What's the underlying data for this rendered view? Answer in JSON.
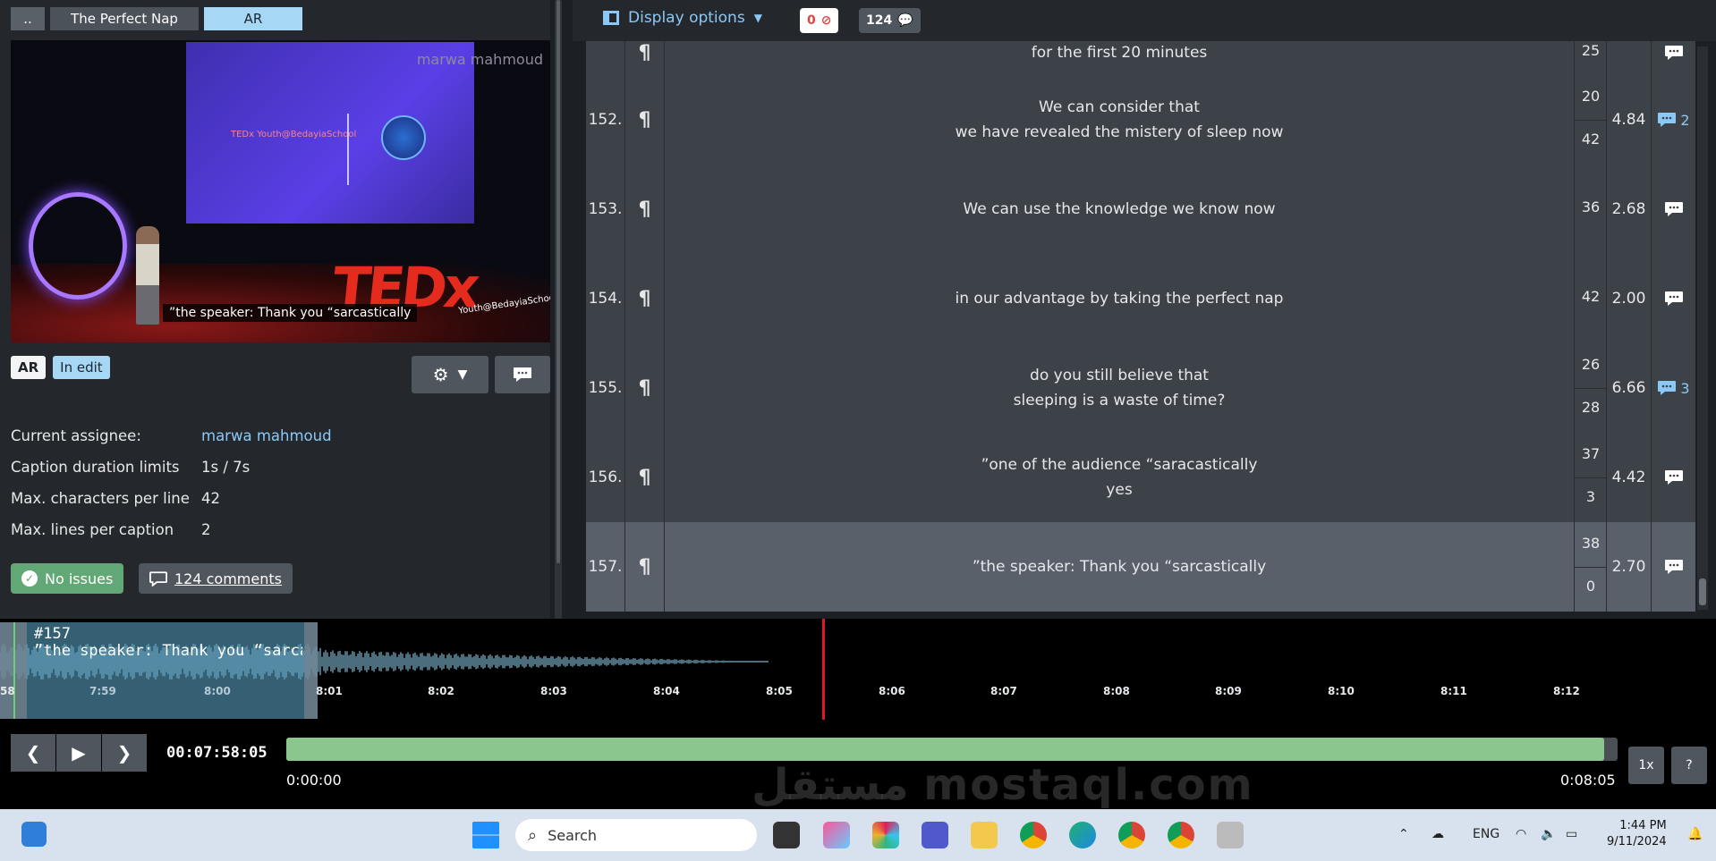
{
  "breadcrumbs": [
    "..",
    "The Perfect Nap",
    "AR"
  ],
  "video": {
    "watermark": "marwa mahmoud",
    "subtitle": "”the speaker: Thank you “sarcastically",
    "screen_logo": "TEDx Youth@BedayiaSchool",
    "tedx_sub": "Youth@BedayiaSchool"
  },
  "badges": {
    "language": "AR",
    "status": "In edit"
  },
  "info": [
    {
      "label": "Current assignee:",
      "value": "marwa mahmoud"
    },
    {
      "label": "Caption duration limits",
      "value": "1s / 7s"
    },
    {
      "label": "Max. characters per line",
      "value": "42"
    },
    {
      "label": "Max. lines per caption",
      "value": "2"
    }
  ],
  "status": {
    "issues": "No issues",
    "comments": "124 comments"
  },
  "toolbar": {
    "display_options": "Display options",
    "errors": "0",
    "comments": "124"
  },
  "rows": [
    {
      "num": "",
      "lines": [
        "for the first 20 minutes"
      ],
      "cps": [
        "25"
      ],
      "dur": "",
      "comments": ""
    },
    {
      "num": "152.",
      "lines": [
        "We can consider that",
        "we have revealed the mistery of sleep now"
      ],
      "cps": [
        "20",
        "42"
      ],
      "dur": "4.84",
      "comments": "2"
    },
    {
      "num": "153.",
      "lines": [
        "We can use the knowledge we know now"
      ],
      "cps": [
        "36"
      ],
      "dur": "2.68",
      "comments": ""
    },
    {
      "num": "154.",
      "lines": [
        "in our advantage by taking the perfect nap"
      ],
      "cps": [
        "42"
      ],
      "dur": "2.00",
      "comments": ""
    },
    {
      "num": "155.",
      "lines": [
        "do you still believe that",
        "sleeping is a waste of time?"
      ],
      "cps": [
        "26",
        "28"
      ],
      "dur": "6.66",
      "comments": "3"
    },
    {
      "num": "156.",
      "lines": [
        "”one of the audience “saracastically",
        "yes"
      ],
      "cps": [
        "37",
        "3"
      ],
      "dur": "4.42",
      "comments": ""
    },
    {
      "num": "157.",
      "lines": [
        "”the speaker: Thank you “sarcastically"
      ],
      "cps": [
        "38",
        "0"
      ],
      "dur": "2.70",
      "comments": ""
    }
  ],
  "waveform": {
    "caption_id": "#157",
    "caption_text": "”the speaker: Thank you “sarcastically",
    "ticks": [
      "58",
      "7:59",
      "8:00",
      "8:01",
      "8:02",
      "8:03",
      "8:04",
      "8:05",
      "8:06",
      "8:07",
      "8:08",
      "8:09",
      "8:10",
      "8:11",
      "8:12"
    ]
  },
  "transport": {
    "current": "00:07:58:05",
    "start": "0:00:00",
    "end": "0:08:05",
    "progress": 0.99,
    "speed": "1x",
    "help": "?"
  },
  "watermark": "مستقل mostaql.com",
  "taskbar": {
    "search": "Search",
    "lang": "ENG",
    "time": "1:44 PM",
    "date": "9/11/2024"
  },
  "colors": {
    "accent": "#8cc8f5",
    "selected_row": "#59606a",
    "ok": "#62a876",
    "progress": "#8bc68e",
    "cursor": "#e01a1a"
  }
}
